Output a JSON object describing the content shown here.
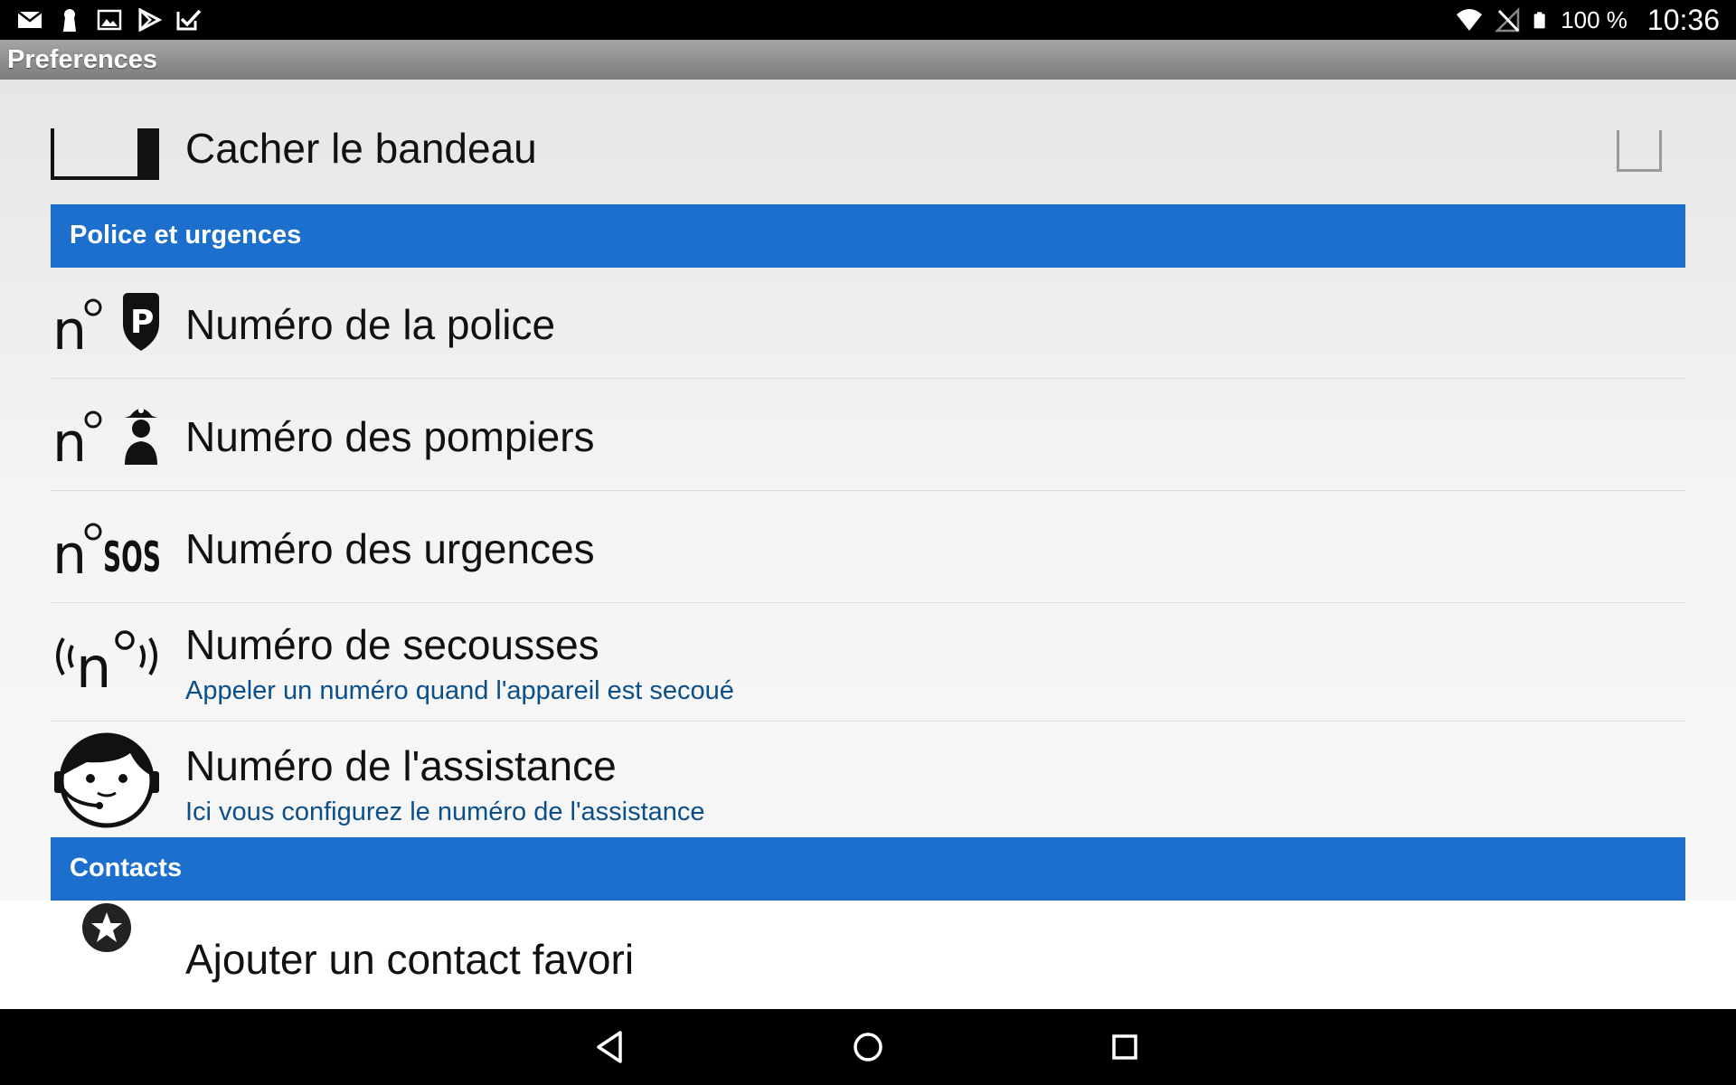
{
  "status_bar": {
    "notification_icons": [
      "email-icon",
      "keyhole-icon",
      "image-icon",
      "play-store-icon",
      "checkbox-icon"
    ],
    "wifi_icon": "wifi-icon",
    "signal_icon": "no-signal-icon",
    "battery_icon": "battery-icon",
    "battery_text": "100 %",
    "time": "10:36"
  },
  "app": {
    "title": "Preferences"
  },
  "preferences": {
    "hide_banner": {
      "title": "Cacher le bandeau",
      "checked": false,
      "icon": "banner-icon"
    },
    "category_police": {
      "label": "Police et urgences"
    },
    "police_number": {
      "title": "Numéro de la police",
      "icon": "police-number-icon"
    },
    "firefighters_number": {
      "title": "Numéro des pompiers",
      "icon": "firefighter-number-icon"
    },
    "emergency_number": {
      "title": "Numéro des urgences",
      "icon": "sos-number-icon"
    },
    "shake_number": {
      "title": "Numéro de secousses",
      "summary": "Appeler un numéro quand l'appareil est secoué",
      "icon": "shake-number-icon"
    },
    "assistance_number": {
      "title": "Numéro de l'assistance",
      "summary": "Ici vous configurez le numéro de l'assistance",
      "icon": "assistance-headset-icon"
    },
    "category_contacts": {
      "label": "Contacts"
    },
    "add_favorite": {
      "title": "Ajouter un contact favori",
      "icon": "star-icon"
    }
  },
  "nav_bar": {
    "back": "back-icon",
    "home": "home-icon",
    "recents": "recents-icon"
  },
  "colors": {
    "category_header": "#1c6fcd",
    "summary_text": "#0b4f8a",
    "title_bar": "#8c8c8c"
  }
}
